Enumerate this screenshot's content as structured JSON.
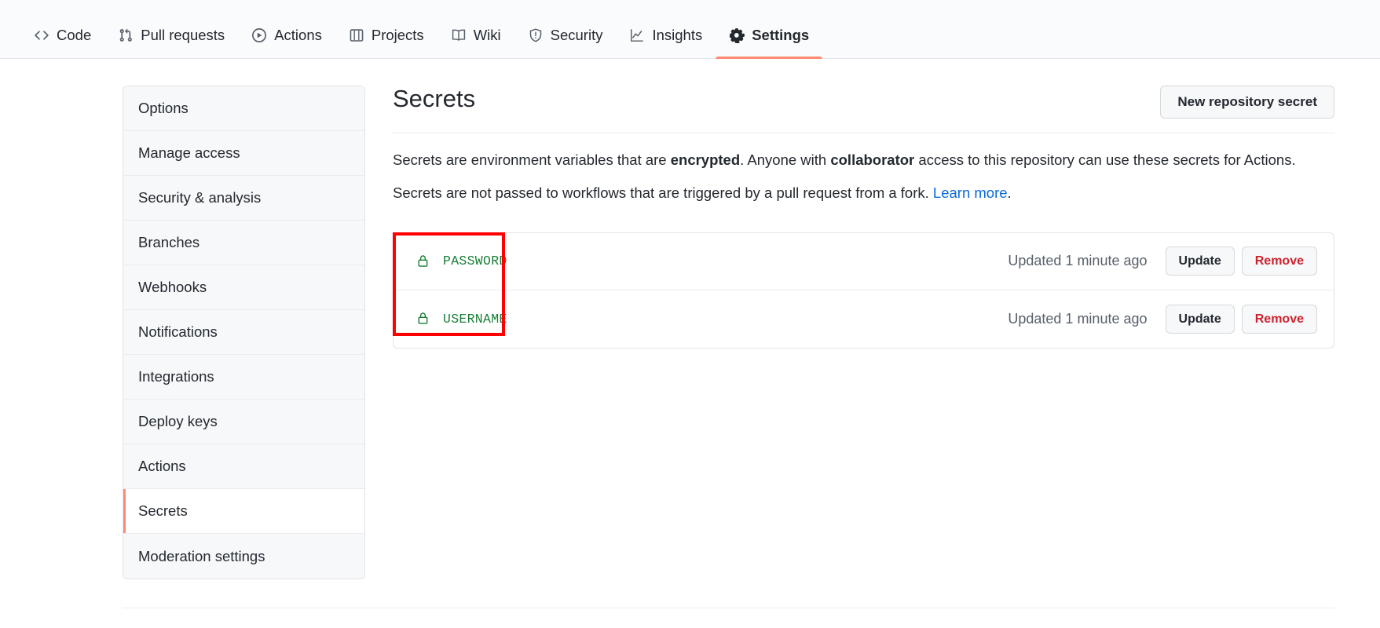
{
  "repo_nav": {
    "items": [
      {
        "label": "Code",
        "icon": "code-icon",
        "active": false
      },
      {
        "label": "Pull requests",
        "icon": "git-pull-request-icon",
        "active": false
      },
      {
        "label": "Actions",
        "icon": "play-circle-icon",
        "active": false
      },
      {
        "label": "Projects",
        "icon": "project-board-icon",
        "active": false
      },
      {
        "label": "Wiki",
        "icon": "book-icon",
        "active": false
      },
      {
        "label": "Security",
        "icon": "shield-alert-icon",
        "active": false
      },
      {
        "label": "Insights",
        "icon": "graph-icon",
        "active": false
      },
      {
        "label": "Settings",
        "icon": "gear-icon",
        "active": true
      }
    ],
    "active_underline_color": "#fd8c73"
  },
  "sidebar": {
    "items": [
      {
        "label": "Options",
        "selected": false
      },
      {
        "label": "Manage access",
        "selected": false
      },
      {
        "label": "Security & analysis",
        "selected": false
      },
      {
        "label": "Branches",
        "selected": false
      },
      {
        "label": "Webhooks",
        "selected": false
      },
      {
        "label": "Notifications",
        "selected": false
      },
      {
        "label": "Integrations",
        "selected": false
      },
      {
        "label": "Deploy keys",
        "selected": false
      },
      {
        "label": "Actions",
        "selected": false
      },
      {
        "label": "Secrets",
        "selected": true
      },
      {
        "label": "Moderation settings",
        "selected": false
      }
    ],
    "selected_marker_color": "#fd8c73"
  },
  "main": {
    "title": "Secrets",
    "new_secret_button": "New repository secret",
    "description_1": {
      "part1": "Secrets are environment variables that are ",
      "bold1": "encrypted",
      "part2": ". Anyone with ",
      "bold2": "collaborator",
      "part3": " access to this repository can use these secrets for Actions."
    },
    "description_2": {
      "text": "Secrets are not passed to workflows that are triggered by a pull request from a fork. ",
      "link": "Learn more",
      "tail": "."
    },
    "secrets": [
      {
        "name": "PASSWORD",
        "icon": "lock-icon",
        "updated": "Updated 1 minute ago",
        "update_label": "Update",
        "remove_label": "Remove"
      },
      {
        "name": "USERNAME",
        "icon": "lock-icon",
        "updated": "Updated 1 minute ago",
        "update_label": "Update",
        "remove_label": "Remove"
      }
    ]
  },
  "colors": {
    "accent_underline": "#fd8c73",
    "secret_name": "#1a7f37",
    "link": "#0969da",
    "danger": "#cf222e",
    "annotation_box": "#fe0000",
    "sidebar_item_bg": "#f6f8fa"
  }
}
